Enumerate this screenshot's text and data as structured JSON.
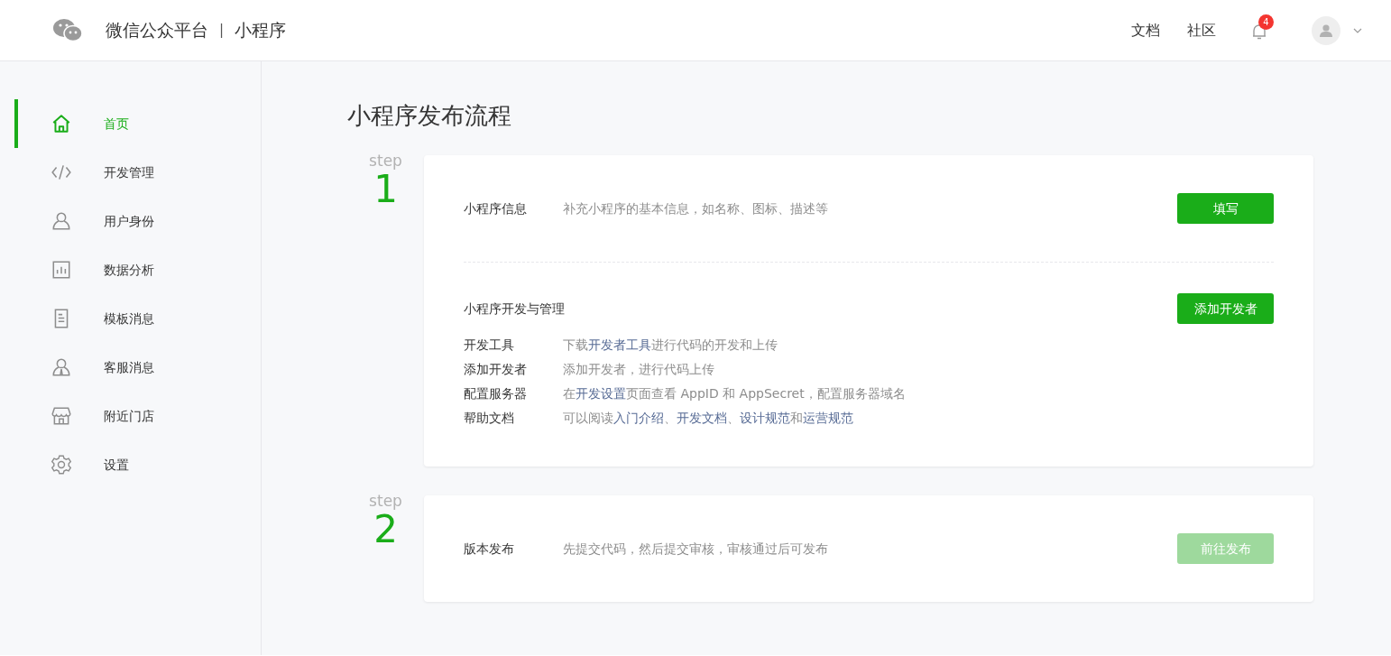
{
  "header": {
    "brand": "微信公众平台",
    "separator": "|",
    "product": "小程序",
    "links": [
      "文档",
      "社区"
    ],
    "notification_count": "4"
  },
  "sidebar": {
    "items": [
      {
        "label": "首页",
        "kind": "home",
        "selected": true
      },
      {
        "label": "开发管理",
        "kind": "code",
        "selected": false
      },
      {
        "label": "用户身份",
        "kind": "user",
        "selected": false
      },
      {
        "label": "数据分析",
        "kind": "chart",
        "selected": false
      },
      {
        "label": "模板消息",
        "kind": "doc",
        "selected": false
      },
      {
        "label": "客服消息",
        "kind": "service",
        "selected": false
      },
      {
        "label": "附近门店",
        "kind": "store",
        "selected": false
      },
      {
        "label": "设置",
        "kind": "settings",
        "selected": false
      }
    ]
  },
  "page_title": "小程序发布流程",
  "steps": [
    {
      "step_label": "step",
      "number": "1",
      "sections": [
        {
          "kind": "single",
          "title": "小程序信息",
          "description": "补充小程序的基本信息，如名称、图标、描述等",
          "button": {
            "label": "填写",
            "disabled": false
          }
        },
        {
          "kind": "list",
          "title": "小程序开发与管理",
          "button": {
            "label": "添加开发者",
            "disabled": false
          },
          "rows": [
            {
              "label": "开发工具",
              "segments": [
                {
                  "text": "下载",
                  "link": false
                },
                {
                  "text": "开发者工具",
                  "link": true
                },
                {
                  "text": "进行代码的开发和上传",
                  "link": false
                }
              ]
            },
            {
              "label": "添加开发者",
              "segments": [
                {
                  "text": "添加开发者，进行代码上传",
                  "link": false
                }
              ]
            },
            {
              "label": "配置服务器",
              "segments": [
                {
                  "text": "在",
                  "link": false
                },
                {
                  "text": "开发设置",
                  "link": true
                },
                {
                  "text": "页面查看 AppID 和 AppSecret，配置服务器域名",
                  "link": false
                }
              ]
            },
            {
              "label": "帮助文档",
              "segments": [
                {
                  "text": "可以阅读",
                  "link": false
                },
                {
                  "text": "入门介绍",
                  "link": true
                },
                {
                  "text": "、",
                  "link": false
                },
                {
                  "text": "开发文档",
                  "link": true
                },
                {
                  "text": "、",
                  "link": false
                },
                {
                  "text": "设计规范",
                  "link": true
                },
                {
                  "text": "和",
                  "link": false
                },
                {
                  "text": "运营规范",
                  "link": true
                }
              ]
            }
          ]
        }
      ]
    },
    {
      "step_label": "step",
      "number": "2",
      "sections": [
        {
          "kind": "single",
          "title": "版本发布",
          "description": "先提交代码，然后提交审核，审核通过后可发布",
          "button": {
            "label": "前往发布",
            "disabled": true
          }
        }
      ]
    }
  ]
}
